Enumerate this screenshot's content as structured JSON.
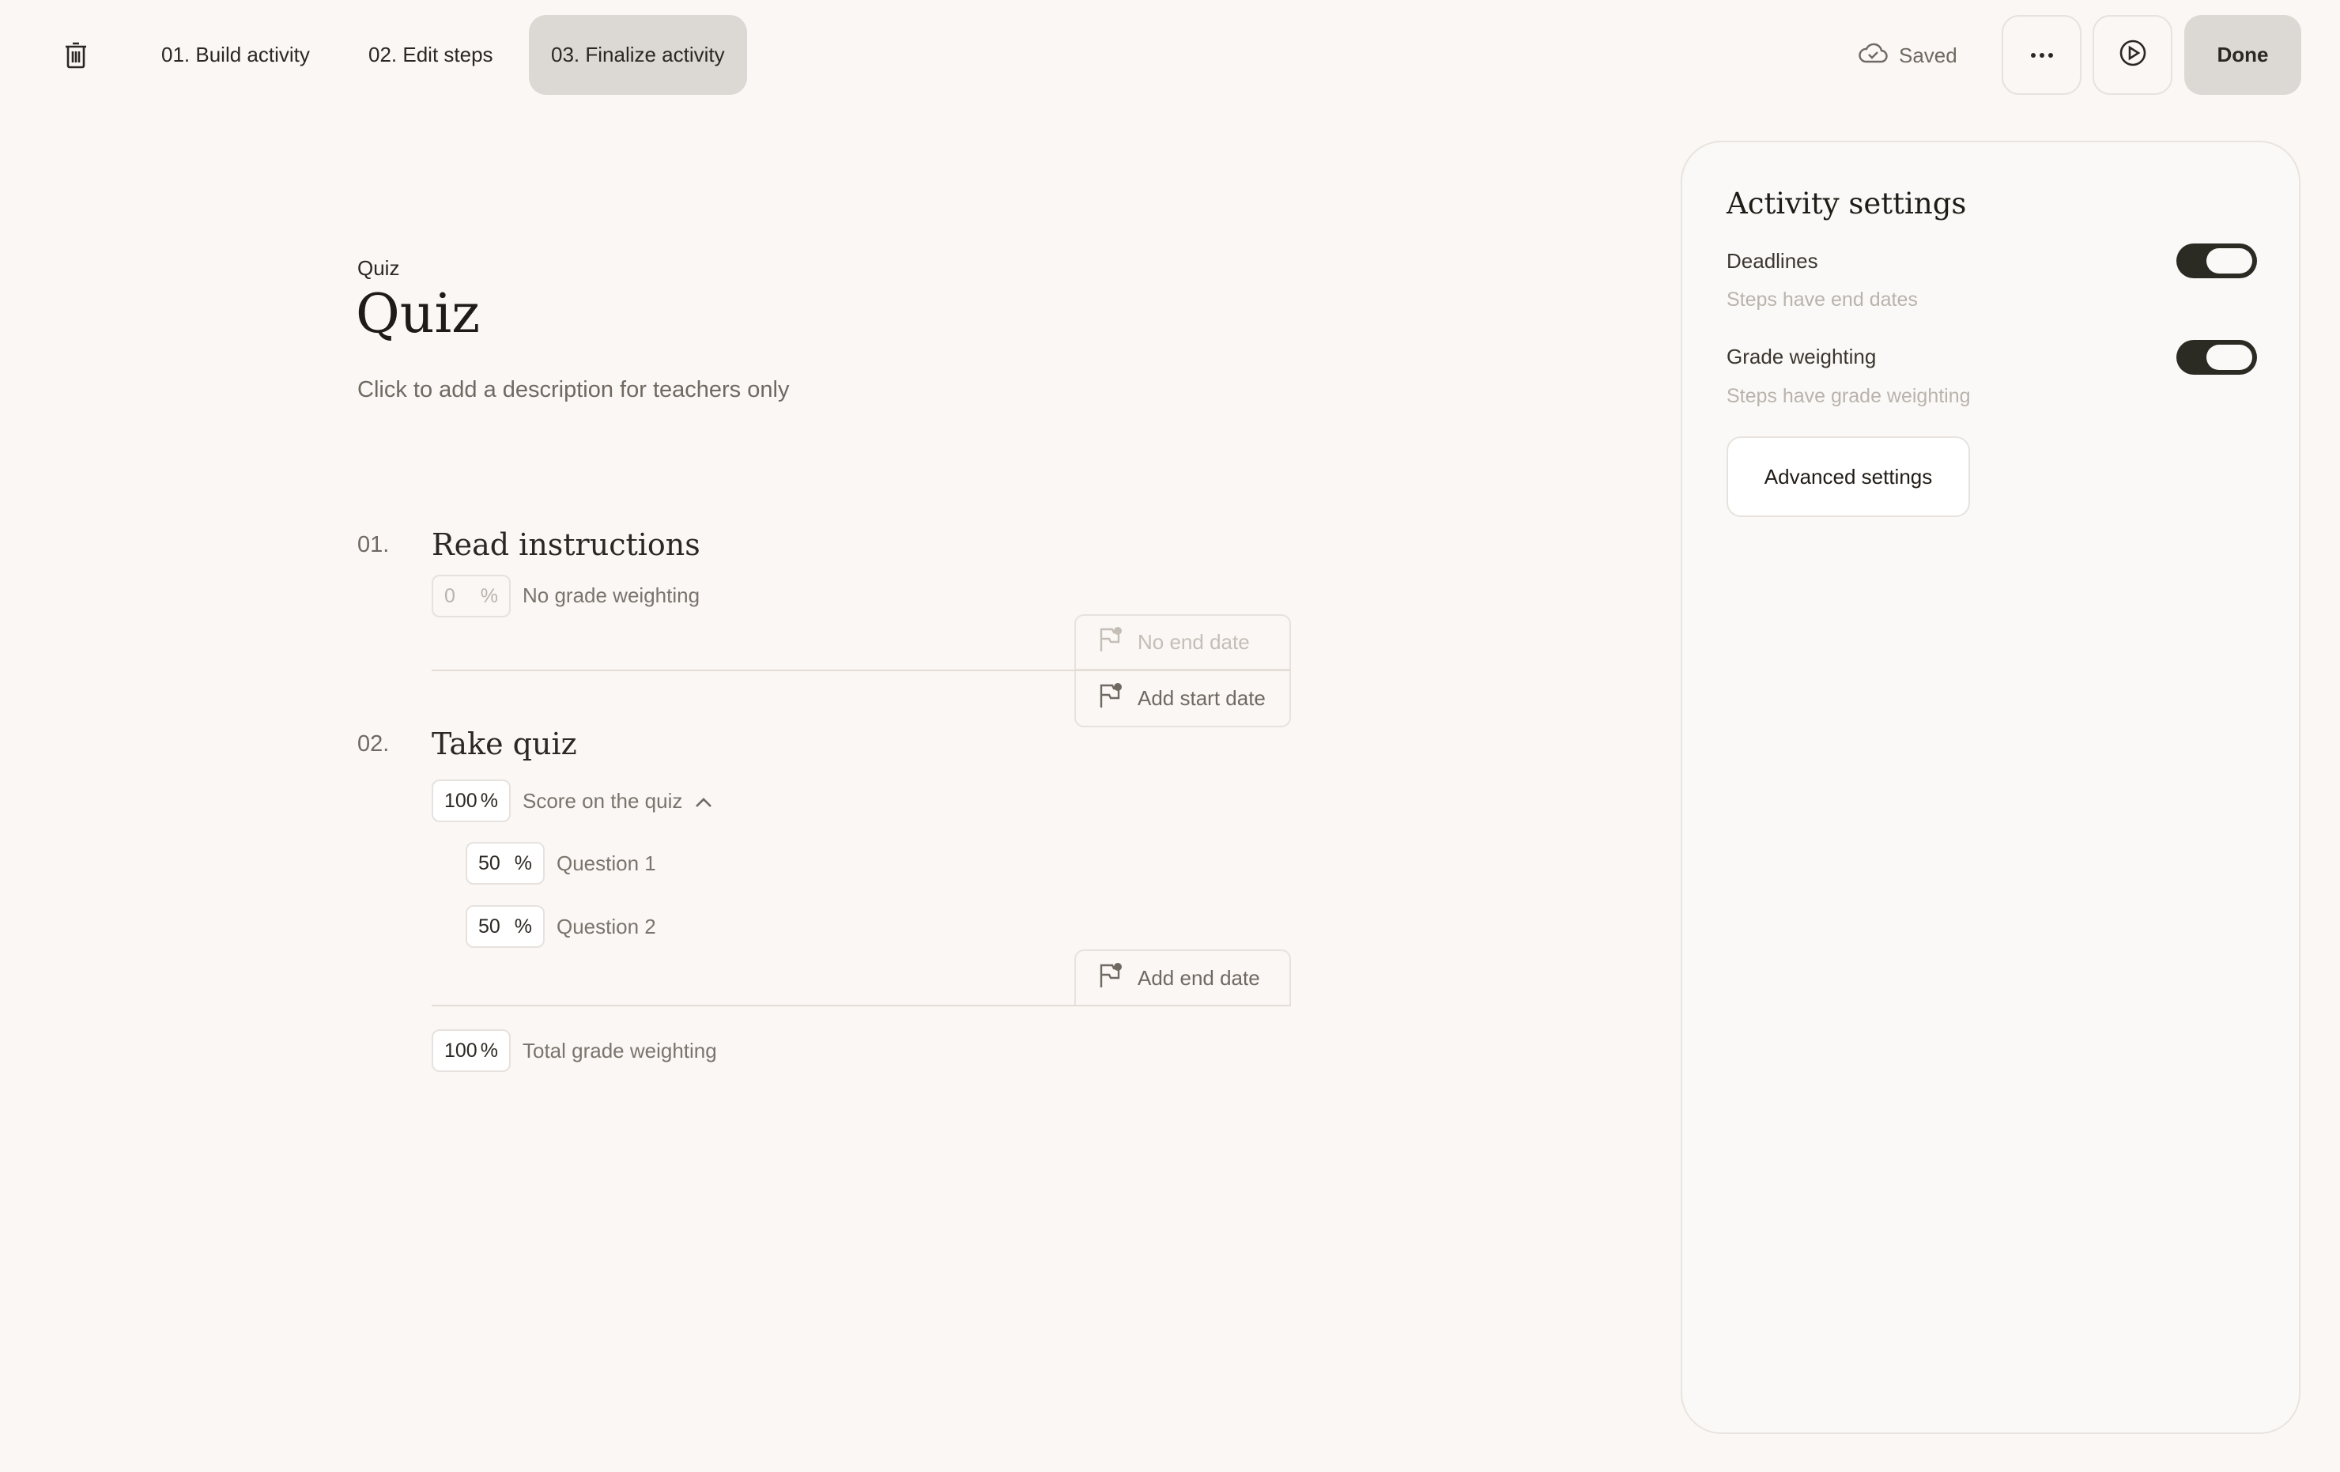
{
  "header": {
    "tabs": [
      {
        "label": "01. Build activity"
      },
      {
        "label": "02. Edit steps"
      },
      {
        "label": "03. Finalize activity",
        "active": true
      }
    ],
    "saved_label": "Saved",
    "done_label": "Done"
  },
  "activity": {
    "kicker": "Quiz",
    "title": "Quiz",
    "description_placeholder": "Click to add a description for teachers only"
  },
  "steps": [
    {
      "number": "01.",
      "title": "Read instructions",
      "weight": "0",
      "weight_label": "No grade weighting",
      "end_date_label": "No end date",
      "start_date_label": "Add start date"
    },
    {
      "number": "02.",
      "title": "Take quiz",
      "weight": "100",
      "weight_label": "Score on the quiz",
      "questions": [
        {
          "weight": "50",
          "label": "Question 1"
        },
        {
          "weight": "50",
          "label": "Question 2"
        }
      ],
      "end_date_label": "Add end date"
    }
  ],
  "total": {
    "weight": "100",
    "label": "Total grade weighting"
  },
  "percent_sign": "%",
  "settings": {
    "title": "Activity settings",
    "items": [
      {
        "label": "Deadlines",
        "help": "Steps have end dates",
        "enabled": true
      },
      {
        "label": "Grade weighting",
        "help": "Steps have grade weighting",
        "enabled": true
      }
    ],
    "advanced_label": "Advanced settings"
  },
  "colors": {
    "accent_dark": "#2b2a23",
    "background": "#faf7f4",
    "active_tab": "#dcd8d4"
  }
}
